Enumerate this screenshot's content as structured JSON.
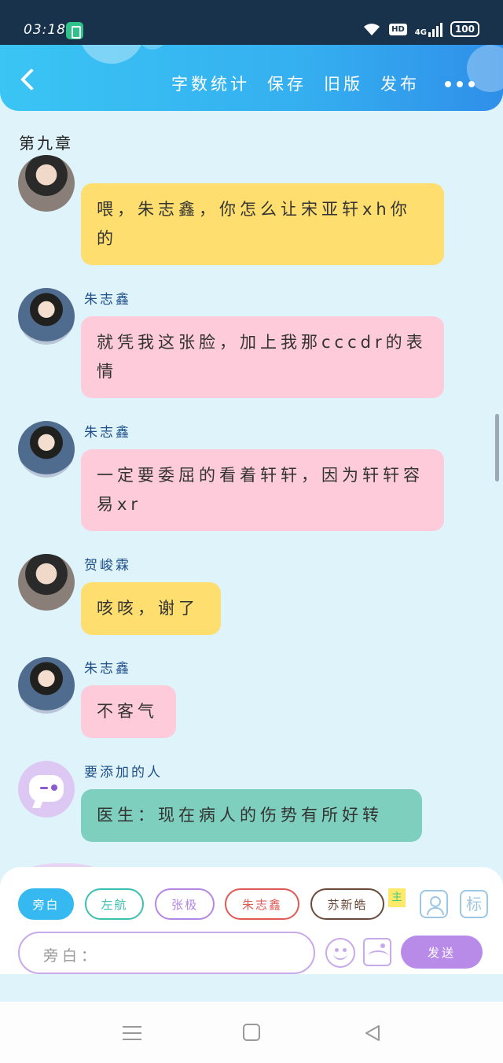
{
  "status_bar": {
    "time": "03:18",
    "hd": "HD",
    "network": "4G",
    "battery": "100"
  },
  "header": {
    "actions": [
      "字数统计",
      "保存",
      "旧版",
      "发布"
    ],
    "more": "•••"
  },
  "chapter_title": "第九章",
  "messages": [
    {
      "sender": "",
      "avatar": "avatar-he",
      "color": "yellow",
      "text": "喂，朱志鑫，你怎么让宋亚轩xh你的"
    },
    {
      "sender": "朱志鑫",
      "avatar": "avatar-zhu",
      "color": "pink",
      "text": "就凭我这张脸，加上我那cccdr的表情"
    },
    {
      "sender": "朱志鑫",
      "avatar": "avatar-zhu",
      "color": "pink",
      "text": "一定要委屈的看着轩轩，因为轩轩容易xr"
    },
    {
      "sender": "贺峻霖",
      "avatar": "avatar-he",
      "color": "yellow",
      "text": "咳咳，谢了"
    },
    {
      "sender": "朱志鑫",
      "avatar": "avatar-zhu",
      "color": "pink",
      "text": "不客气"
    },
    {
      "sender": "要添加的人",
      "avatar": "avatar-bot",
      "color": "teal",
      "text": "医生：现在病人的伤势有所好转"
    }
  ],
  "characters": [
    {
      "label": "旁白",
      "border": "#36b8f0",
      "text_color": "#ffffff",
      "active": true
    },
    {
      "label": "左航",
      "border": "#3bbfb0",
      "text_color": "#3bbfb0",
      "active": false
    },
    {
      "label": "张极",
      "border": "#b486e6",
      "text_color": "#b486e6",
      "active": false
    },
    {
      "label": "朱志鑫",
      "border": "#e05a55",
      "text_color": "#e05a55",
      "active": false
    },
    {
      "label": "苏新皓",
      "border": "#6b4a3a",
      "text_color": "#6b4a3a",
      "active": false
    }
  ],
  "lead_badge": "主",
  "tag_button": "标",
  "input": {
    "label": "旁白：",
    "value": "",
    "placeholder": ""
  },
  "send_label": "发送"
}
